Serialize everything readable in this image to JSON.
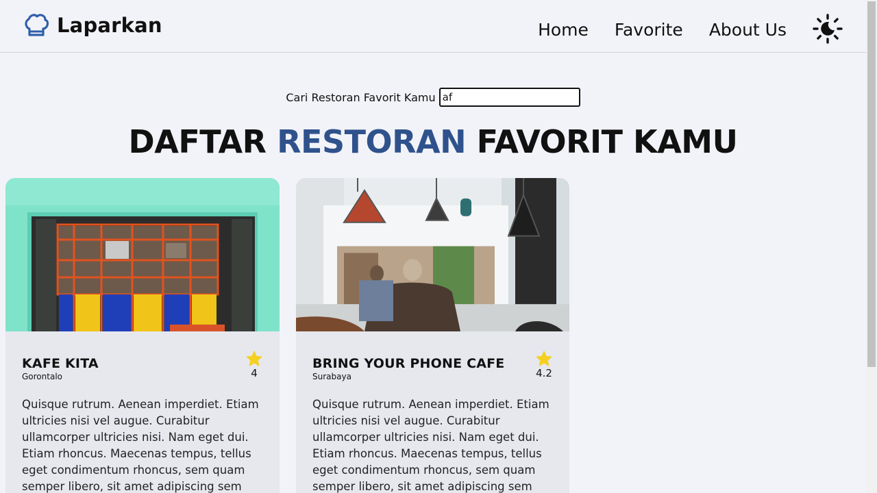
{
  "header": {
    "brand": "Laparkan",
    "nav": [
      {
        "label": "Home"
      },
      {
        "label": "Favorite"
      },
      {
        "label": "About Us"
      }
    ],
    "brand_icon": "chef-hat-icon",
    "theme_icon": "sun-moon-icon"
  },
  "search": {
    "label": "Cari Restoran Favorit Kamu",
    "value": "af"
  },
  "title": {
    "part1": "DAFTAR ",
    "accent": "RESTORAN",
    "part2": " FAVORIT KAMU"
  },
  "colors": {
    "accent": "#2f528c",
    "star": "#f5d020",
    "background": "#f2f3f8",
    "card": "#e6e8ee"
  },
  "restaurants": [
    {
      "name": "KAFE KITA",
      "city": "Gorontalo",
      "rating": "4",
      "description": "Quisque rutrum. Aenean imperdiet. Etiam ultricies nisi vel augue. Curabitur ullamcorper ultricies nisi. Nam eget dui. Etiam rhoncus. Maecenas tempus, tellus eget condimentum rhoncus, sem quam semper libero, sit amet adipiscing sem"
    },
    {
      "name": "BRING YOUR PHONE CAFE",
      "city": "Surabaya",
      "rating": "4.2",
      "description": "Quisque rutrum. Aenean imperdiet. Etiam ultricies nisi vel augue. Curabitur ullamcorper ultricies nisi. Nam eget dui. Etiam rhoncus. Maecenas tempus, tellus eget condimentum rhoncus, sem quam semper libero, sit amet adipiscing sem"
    }
  ]
}
